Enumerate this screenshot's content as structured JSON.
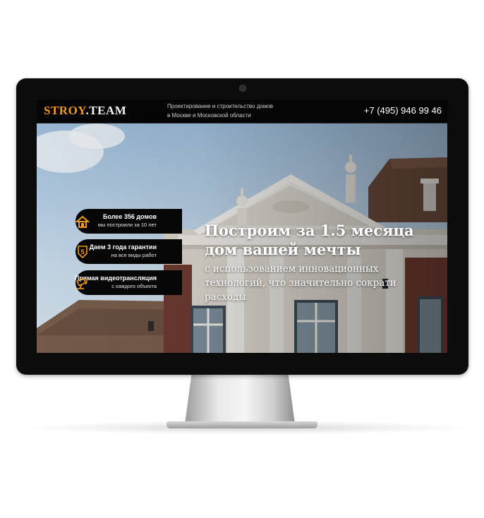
{
  "header": {
    "logo_part1": "STROY",
    "logo_part2": ".TEAM",
    "tagline_line1": "Проектирование и строительство домов",
    "tagline_line2": "в Москве и Московской области",
    "phone": "+7 (495) 946 99 46"
  },
  "hero": {
    "headline_line1": "Построим за 1.5 месяца",
    "headline_line2": "дом вашей мечты",
    "subtext_line1": "с использованием инновационных",
    "subtext_line2": "технологий, что значительно сократи",
    "subtext_line3": "расходы"
  },
  "features": [
    {
      "title": "Более 356 домов",
      "subtitle": "мы построили за 10 лет",
      "icon": "house-icon"
    },
    {
      "title": "Даем 3 года гарантии",
      "subtitle": "на все виды работ",
      "icon": "shield-5-icon"
    },
    {
      "title": "Прямая видеотрансляция",
      "subtitle": "с каждого объекта",
      "icon": "camera-icon"
    }
  ],
  "colors": {
    "accent": "#f29a1d",
    "header_bg": "#050505",
    "pill_bg": "#060606"
  }
}
